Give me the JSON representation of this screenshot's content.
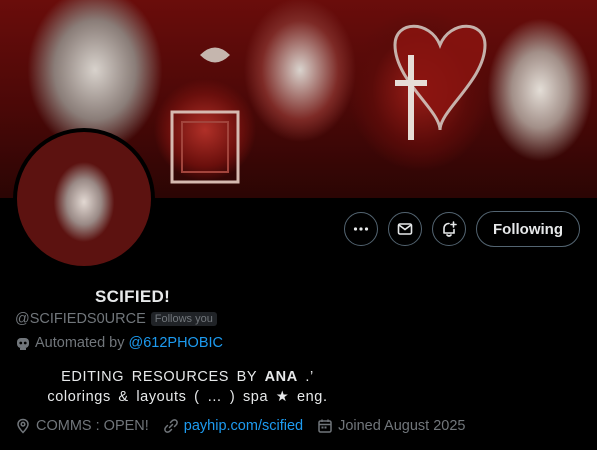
{
  "profile": {
    "display_name": "SCIFIED!",
    "handle": "@SCIFIEDS0URCE",
    "follows_you_badge": "Follows you",
    "automated_prefix": "Automated by",
    "automated_by": "@612PHOBIC",
    "bio_line1_prefix": "EDITING  RESOURCES  BY",
    "bio_line1_name": "ANA",
    "bio_line1_suffix": ".’",
    "bio_line2": "colorings  &  layouts  (  …  )  spa  ★  eng.",
    "location": "COMMS  :  OPEN!",
    "website": "payhip.com/scified",
    "joined": "Joined August 2025"
  },
  "actions": {
    "follow_label": "Following"
  },
  "icons": {
    "more": "more-icon",
    "message": "envelope-icon",
    "notify": "bell-plus-icon",
    "automated": "robot-icon",
    "location": "location-pin-icon",
    "link": "link-icon",
    "calendar": "calendar-icon"
  },
  "colors": {
    "link": "#1d9bf0",
    "secondary_text": "#71767b",
    "primary_text": "#e7e9ea",
    "border": "#536471",
    "banner_red": "#6a0d0b"
  }
}
